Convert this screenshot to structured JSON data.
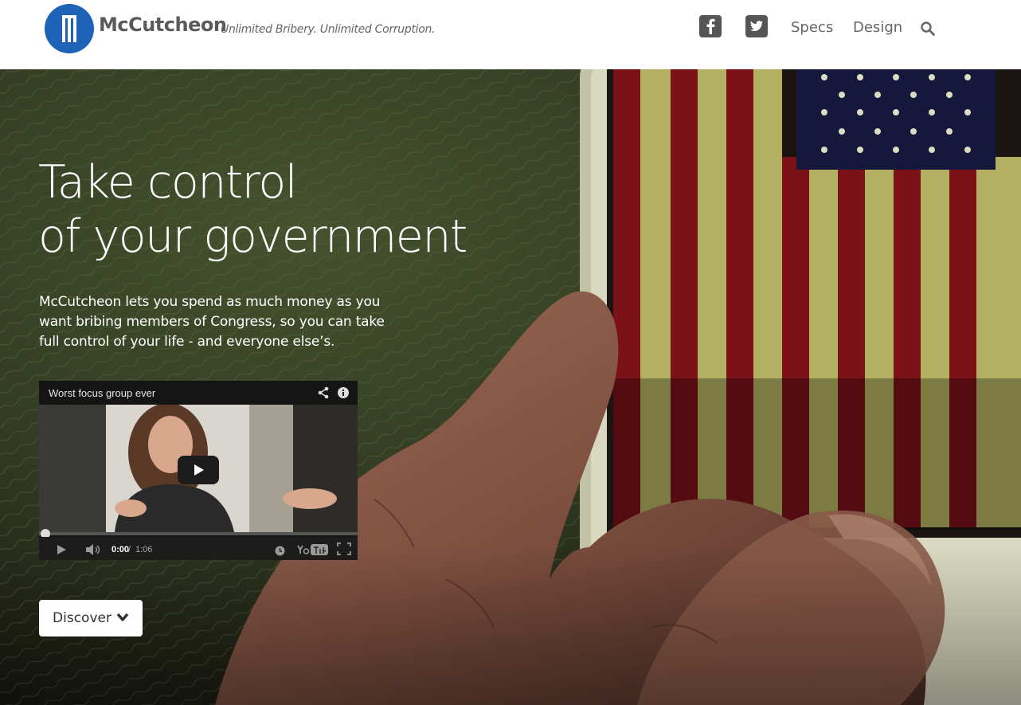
{
  "header": {
    "brand": "McCutcheon",
    "tagline": "Unlimited Bribery. Unlimited Corruption.",
    "nav": {
      "facebook_icon": "facebook-icon",
      "twitter_icon": "twitter-icon",
      "specs": "Specs",
      "design": "Design",
      "search_icon": "search-icon"
    }
  },
  "hero": {
    "headline_line1": "Take control",
    "headline_line2": "of your government",
    "intro": "McCutcheon lets you spend as much money as you want bribing members of Congress, so you can take full control of your life - and everyone else’s."
  },
  "video": {
    "title": "Worst focus group ever",
    "time_current": "0:00",
    "time_separator": "/",
    "time_total": "1:06",
    "progress": 0
  },
  "discover_button": {
    "label": "Discover",
    "icon": "chevron-down-icon"
  },
  "colors": {
    "brand_blue": "#1f63b8",
    "nav_text": "#666666",
    "flag_red": "#7a1218",
    "flag_blue": "#15183a"
  }
}
